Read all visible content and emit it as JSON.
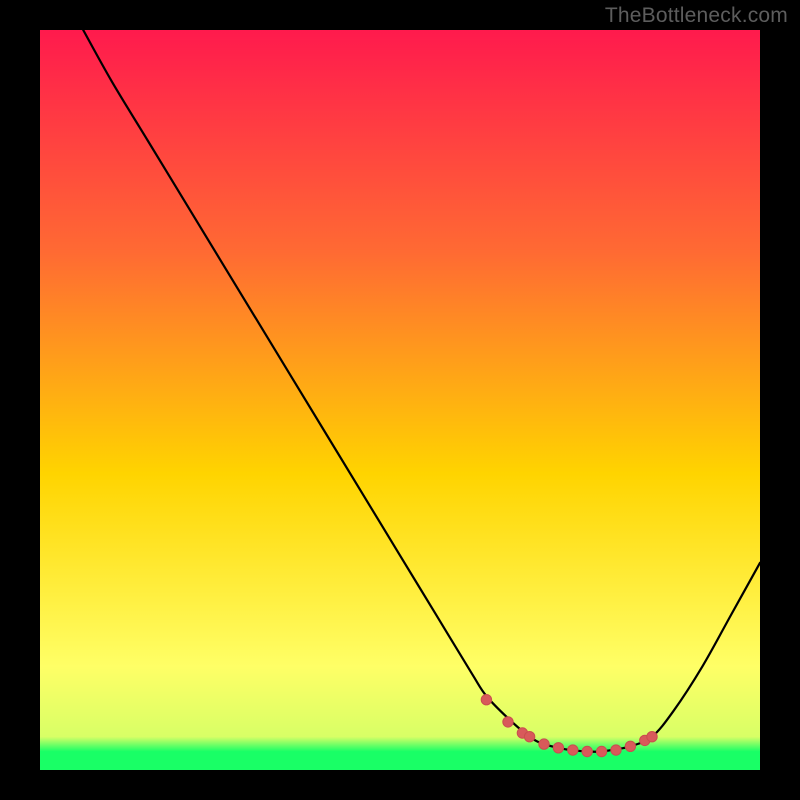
{
  "watermark": "TheBottleneck.com",
  "colors": {
    "bg_black": "#000000",
    "grad_top": "#ff1a4d",
    "grad_mid1": "#ff6a33",
    "grad_mid2": "#ffd400",
    "grad_low": "#ffff66",
    "grad_green": "#19ff66",
    "curve": "#000000",
    "marker_fill": "#d85a5a",
    "marker_stroke": "#c94f4f"
  },
  "chart_data": {
    "type": "line",
    "title": "",
    "xlabel": "",
    "ylabel": "",
    "xlim": [
      0,
      100
    ],
    "ylim": [
      0,
      100
    ],
    "series": [
      {
        "name": "bottleneck-curve",
        "x": [
          6,
          10,
          15,
          20,
          25,
          30,
          35,
          40,
          45,
          50,
          55,
          60,
          62,
          65,
          68,
          70,
          73,
          76,
          78,
          80,
          82,
          85,
          88,
          92,
          96,
          100
        ],
        "y": [
          100,
          93,
          85,
          77,
          69,
          61,
          53,
          45,
          37,
          29,
          21,
          13,
          10,
          7,
          4.5,
          3.5,
          2.8,
          2.5,
          2.5,
          2.8,
          3.2,
          4.5,
          8,
          14,
          21,
          28
        ]
      }
    ],
    "markers": {
      "name": "highlight-points",
      "x": [
        62,
        65,
        67,
        68,
        70,
        72,
        74,
        76,
        78,
        80,
        82,
        84,
        85
      ],
      "y": [
        9.5,
        6.5,
        5,
        4.5,
        3.5,
        3,
        2.7,
        2.5,
        2.5,
        2.7,
        3.2,
        4,
        4.5
      ]
    }
  }
}
